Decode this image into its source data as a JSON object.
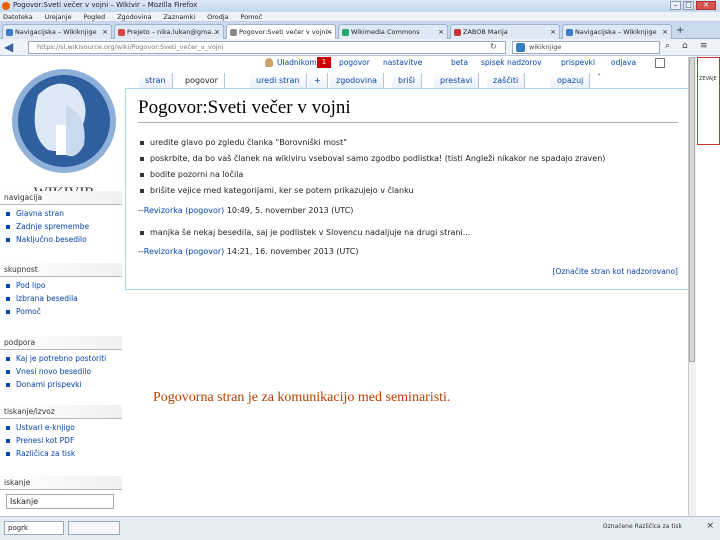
{
  "window": {
    "title": "Pogovor:Sveti večer v vojni – Wikivir – Mozilla Firefox"
  },
  "menu": [
    "Datoteka",
    "Urejanje",
    "Pogled",
    "Zgodovina",
    "Zaznamki",
    "Orodja",
    "Pomoč"
  ],
  "tabs": [
    {
      "label": "Navigacijska – Wikiknjige"
    },
    {
      "label": "Prejeto – nika.lukan@gma..."
    },
    {
      "label": "Pogovor:Sveti večer v vojni – ..."
    },
    {
      "label": "Wikimedia Commons"
    },
    {
      "label": "ZABOB Marija"
    },
    {
      "label": "Navigacijska – Wikiknjige"
    }
  ],
  "nav": {
    "url": "https://sl.wikisource.org/wiki/Pogovor:Sveti_večer_v_vojni",
    "search": "wikiknjige"
  },
  "personal_tools": {
    "user": "Uladnikom",
    "notifications": "1",
    "items": [
      "pogovor",
      "nastavitve",
      "beta",
      "spisek nadzorov",
      "prispevki",
      "odjava"
    ]
  },
  "view_tabs": {
    "left": [
      "stran",
      "pogovor"
    ],
    "right": [
      "uredi stran",
      "+",
      "zgodovina",
      "briši",
      "prestavi",
      "zaščiti",
      "opazuj"
    ]
  },
  "sidebar": {
    "logo_text": "WIKIVIR",
    "sections": [
      {
        "title": "navigacija",
        "items": [
          "Glavna stran",
          "Zadnje spremembe",
          "Naključno besedilo"
        ]
      },
      {
        "title": "skupnost",
        "items": [
          "Pod lipo",
          "Izbrana besedila",
          "Pomoč"
        ]
      },
      {
        "title": "podpora",
        "items": [
          "Kaj je potrebno postoriti",
          "Vnesi novo besedilo",
          "Donami prispevki"
        ]
      },
      {
        "title": "tiskanje/izvoz",
        "items": [
          "Ustvari e-knjigo",
          "Prenesi kot PDF",
          "Različica za tisk"
        ]
      },
      {
        "title": "iskanje",
        "items": []
      }
    ],
    "search_value": "Iskanje"
  },
  "page": {
    "title": "Pogovor:Sveti večer v vojni",
    "bullets1": [
      "uredite glavo po zgledu članka \"Borovniški most\"",
      "poskrbite, da bo vaš članek na wikiviru vseboval samo zgodbo podlistka! (tisti Angleži nikakor ne spadajo zraven)",
      "bodite pozorni na ločila",
      "brišite vejice med kategorijami, ker se potem prikazujejo v članku"
    ],
    "sig1": {
      "prefix": "--",
      "user": "Revizorka",
      "talk": "(pogovor)",
      "date": " 10:49, 5. november 2013 (UTC)"
    },
    "bullets2": [
      "manjka še nekaj besedila, saj je podlistek v Slovencu nadaljuje na drugi strani..."
    ],
    "sig2": {
      "prefix": "--",
      "user": "Revizorka",
      "talk": "(pogovor)",
      "date": " 14:21, 16. november 2013 (UTC)"
    },
    "watch_link": "[Označite stran kot nadzorovano]"
  },
  "caption": "Pogovorna stran je za komunikacijo med seminaristi.",
  "right_panel": "ZEVAJE",
  "find": {
    "value": "pogrk"
  },
  "status_text": "Označene  Različica za tisk"
}
